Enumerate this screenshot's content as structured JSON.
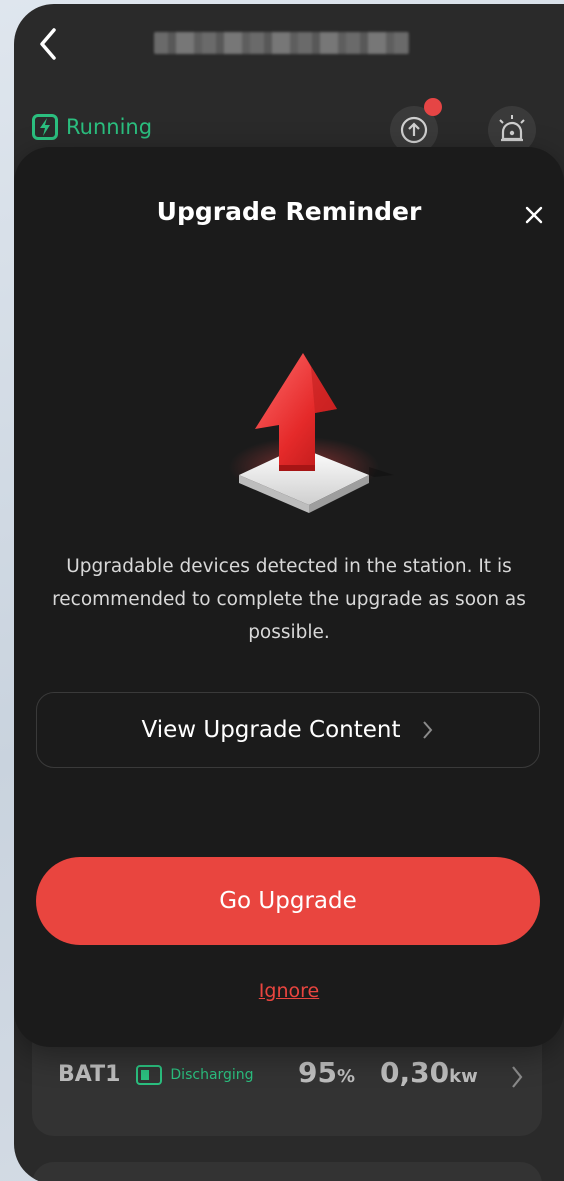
{
  "header": {
    "back_icon": "chevron-left-icon"
  },
  "status": {
    "label": "Running",
    "color": "#2bbf7f",
    "upgrade_icon": "upload-arrow-icon",
    "alarm_icon": "alarm-light-icon"
  },
  "dialog": {
    "title": "Upgrade Reminder",
    "close_icon": "close-icon",
    "illustration": "red-upgrade-arrow-illustration",
    "message": "Upgradable devices detected in the station. It is recommended to complete the upgrade as soon as possible.",
    "view_button_label": "View Upgrade Content",
    "go_button_label": "Go Upgrade",
    "ignore_label": "Ignore",
    "accent_color": "#e9453f"
  },
  "battery": {
    "name": "BAT1",
    "status": "Discharging",
    "percent": "95",
    "percent_unit": "%",
    "power": "0,30",
    "power_unit": "kw"
  }
}
